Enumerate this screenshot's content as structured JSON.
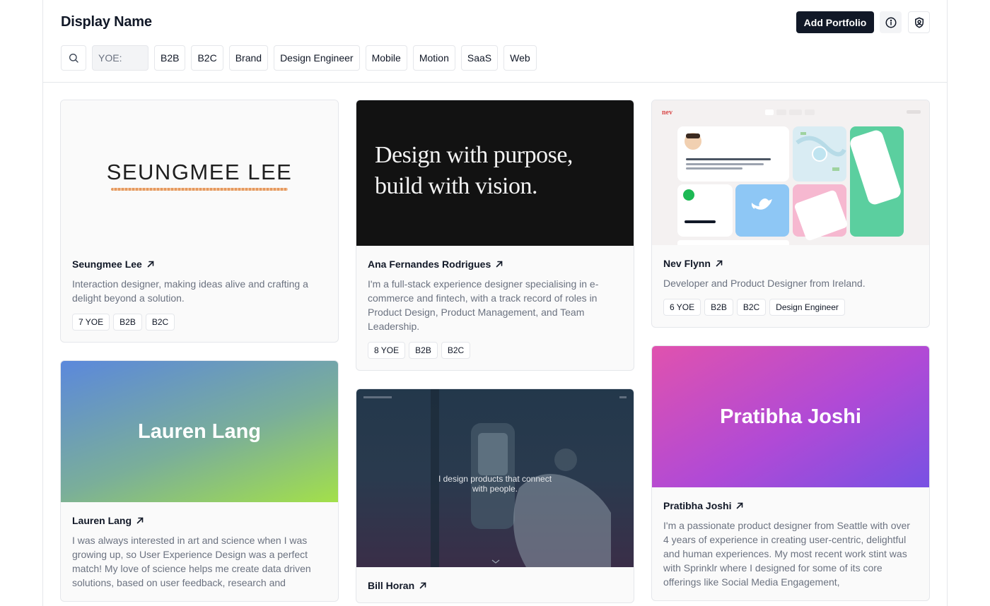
{
  "header": {
    "title": "Display Name",
    "add_label": "Add Portfolio"
  },
  "filters": {
    "yoe_placeholder": "YOE:",
    "chips": [
      "B2B",
      "B2C",
      "Brand",
      "Design Engineer",
      "Mobile",
      "Motion",
      "SaaS",
      "Web"
    ]
  },
  "cards": [
    {
      "name": "Seungmee Lee",
      "image_text": "SEUNGMEE LEE",
      "description": "Interaction designer, making ideas alive and crafting a delight beyond a solution.",
      "tags": [
        "7 YOE",
        "B2B",
        "B2C"
      ]
    },
    {
      "name": "Ana Fernandes Rodrigues",
      "image_text_line1": "Design with purpose,",
      "image_text_line2": "build with vision.",
      "description": "I'm a full-stack experience designer specialising in e-commerce and fintech, with a track record of roles in Product Design, Product Management, and Team Leadership.",
      "tags": [
        "8 YOE",
        "B2B",
        "B2C"
      ]
    },
    {
      "name": "Nev Flynn",
      "image_logo": "nev",
      "description": "Developer and Product Designer from Ireland.",
      "tags": [
        "6 YOE",
        "B2B",
        "B2C",
        "Design Engineer"
      ]
    },
    {
      "name": "Lauren Lang",
      "image_text": "Lauren Lang",
      "description": "I was always interested in art and science when I was growing up, so User Experience Design was a perfect match! My love of science helps me create data driven solutions, based on user feedback, research and",
      "tags": []
    },
    {
      "name": "Bill Horan",
      "image_text_line1": "I design products that connect",
      "image_text_line2": "with people.",
      "description": "",
      "tags": []
    },
    {
      "name": "Pratibha Joshi",
      "image_text": "Pratibha Joshi",
      "description": "I'm a passionate product designer from Seattle with over 4 years of experience in creating user-centric, delightful and human experiences. My most recent work stint was with Sprinklr where I designed for some of its core offerings like Social Media Engagement,",
      "tags": []
    }
  ],
  "icons": {
    "info": "info-icon",
    "shield": "shield-user-icon",
    "search": "search-icon",
    "external": "arrow-up-right-icon"
  },
  "colors": {
    "primary": "#111827",
    "muted_text": "#6b7280",
    "border": "#e5e7eb"
  }
}
